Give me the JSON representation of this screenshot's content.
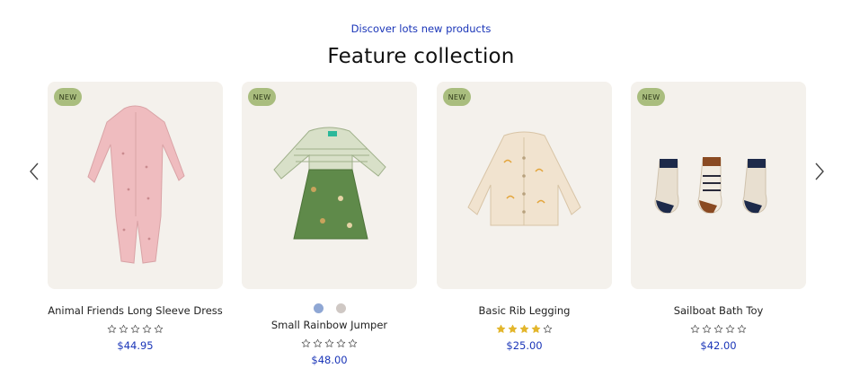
{
  "header": {
    "subtitle": "Discover lots new products",
    "title": "Feature collection"
  },
  "carousel": {
    "prev_icon": "chevron-left-icon",
    "next_icon": "chevron-right-icon"
  },
  "products": [
    {
      "badge": "NEW",
      "name": "Animal Friends Long Sleeve Dress",
      "price": "$44.95",
      "rating": 0,
      "max_rating": 5,
      "swatches": []
    },
    {
      "badge": "NEW",
      "name": "Small Rainbow Jumper",
      "price": "$48.00",
      "rating": 0,
      "max_rating": 5,
      "swatches": [
        "#8fa7d4",
        "#cfc8c4"
      ]
    },
    {
      "badge": "NEW",
      "name": "Basic Rib Legging",
      "price": "$25.00",
      "rating": 4,
      "max_rating": 5,
      "swatches": []
    },
    {
      "badge": "NEW",
      "name": "Sailboat Bath Toy",
      "price": "$42.00",
      "rating": 0,
      "max_rating": 5,
      "swatches": []
    }
  ],
  "colors": {
    "accent": "#1a35b8",
    "badge_bg": "#a9bd7e",
    "card_bg": "#f4f1ec",
    "star_filled": "#e3b62c",
    "star_empty": "#555555"
  }
}
